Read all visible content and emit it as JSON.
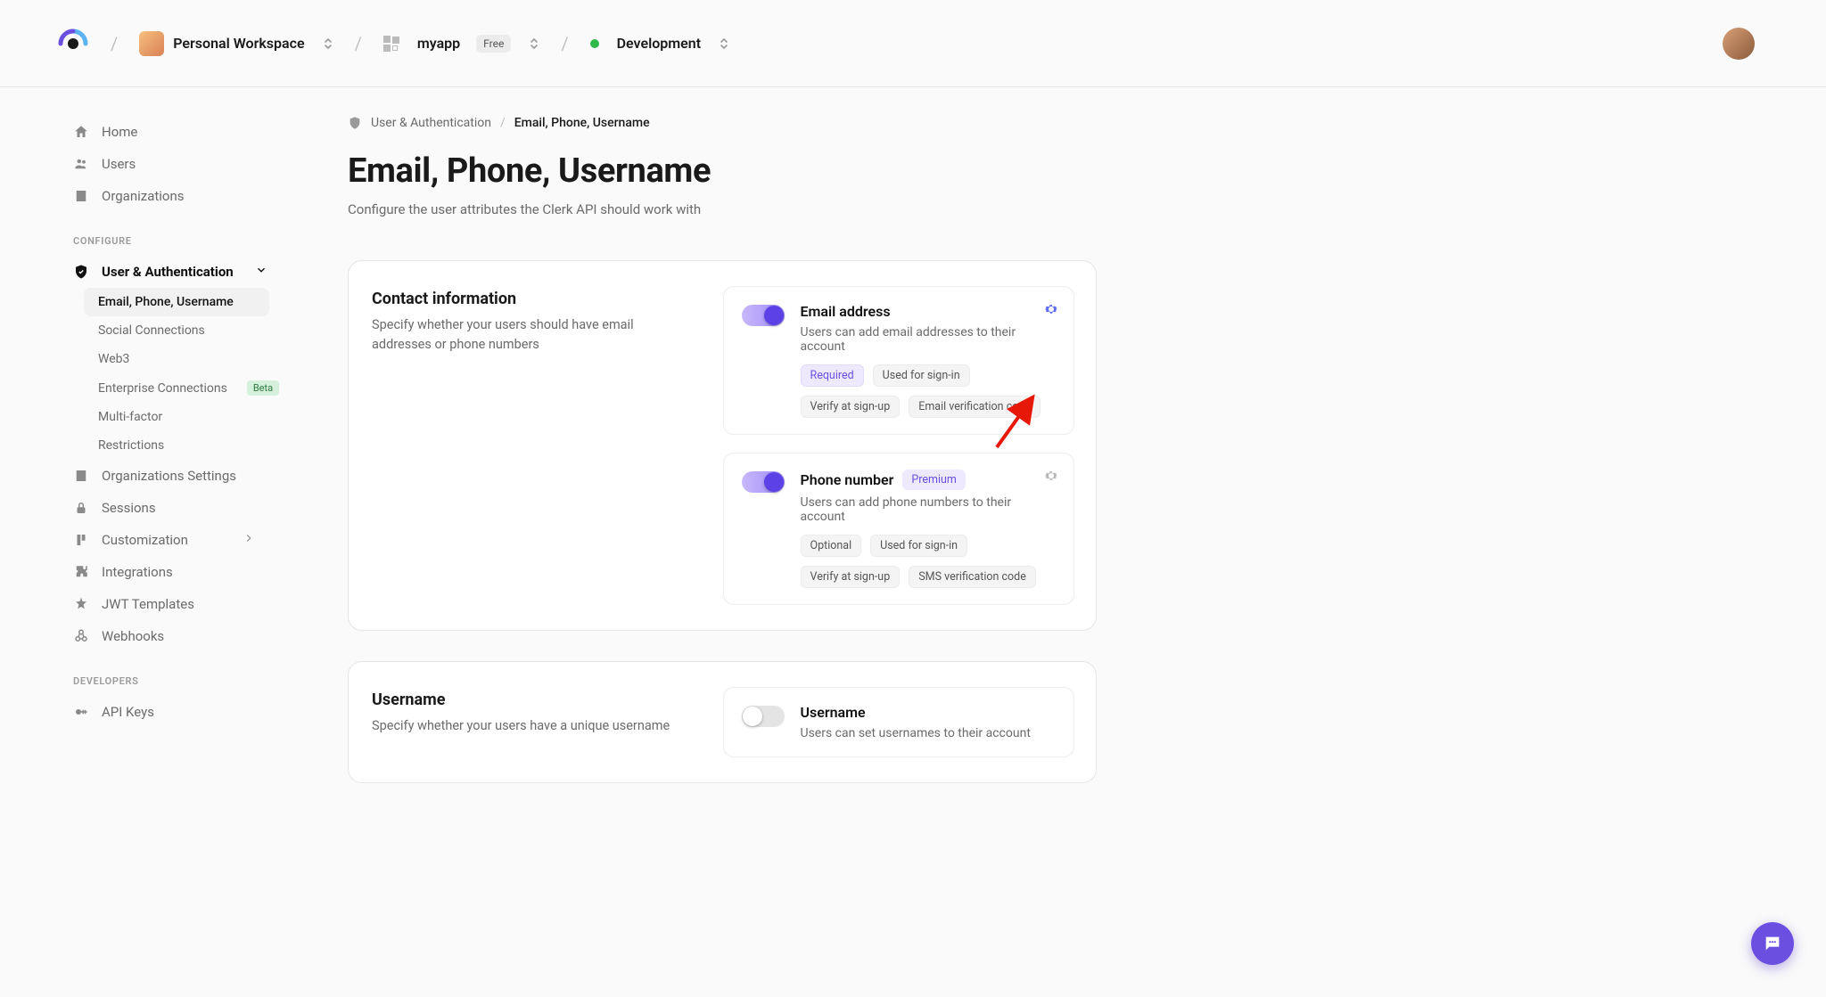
{
  "header": {
    "workspace": "Personal Workspace",
    "app": "myapp",
    "app_badge": "Free",
    "env": "Development"
  },
  "sidebar": {
    "top": [
      {
        "label": "Home"
      },
      {
        "label": "Users"
      },
      {
        "label": "Organizations"
      }
    ],
    "section_configure": "CONFIGURE",
    "user_auth": "User & Authentication",
    "user_auth_sub": [
      {
        "label": "Email, Phone, Username"
      },
      {
        "label": "Social Connections"
      },
      {
        "label": "Web3"
      },
      {
        "label": "Enterprise Connections",
        "beta": "Beta"
      },
      {
        "label": "Multi-factor"
      },
      {
        "label": "Restrictions"
      }
    ],
    "rest": [
      {
        "label": "Organizations Settings"
      },
      {
        "label": "Sessions"
      },
      {
        "label": "Customization",
        "chev": true
      },
      {
        "label": "Integrations"
      },
      {
        "label": "JWT Templates"
      },
      {
        "label": "Webhooks"
      }
    ],
    "section_developers": "DEVELOPERS",
    "dev": [
      {
        "label": "API Keys"
      }
    ]
  },
  "breadcrumb": {
    "root": "User & Authentication",
    "current": "Email, Phone, Username"
  },
  "page": {
    "title": "Email, Phone, Username",
    "subtitle": "Configure the user attributes the Clerk API should work with"
  },
  "sections": {
    "contact": {
      "title": "Contact information",
      "desc": "Specify whether your users should have email addresses or phone numbers",
      "email": {
        "name": "Email address",
        "desc": "Users can add email addresses to their account",
        "chips": [
          "Required",
          "Used for sign-in",
          "Verify at sign-up",
          "Email verification code"
        ]
      },
      "phone": {
        "name": "Phone number",
        "premium": "Premium",
        "desc": "Users can add phone numbers to their account",
        "chips": [
          "Optional",
          "Used for sign-in",
          "Verify at sign-up",
          "SMS verification code"
        ]
      }
    },
    "username": {
      "title": "Username",
      "desc": "Specify whether your users have a unique username",
      "attr": {
        "name": "Username",
        "desc": "Users can set usernames to their account"
      }
    }
  }
}
